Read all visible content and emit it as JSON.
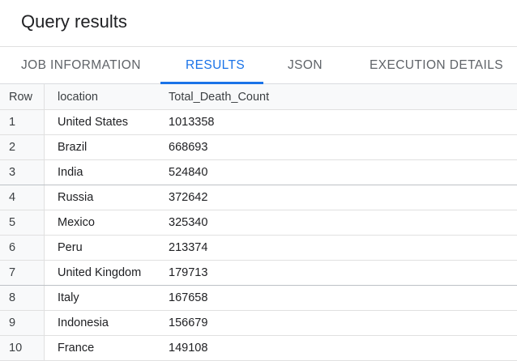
{
  "header": {
    "title": "Query results"
  },
  "tabs": [
    {
      "label": "JOB INFORMATION",
      "active": false
    },
    {
      "label": "RESULTS",
      "active": true
    },
    {
      "label": "JSON",
      "active": false
    },
    {
      "label": "EXECUTION DETAILS",
      "active": false
    }
  ],
  "colors": {
    "accent": "#1a73e8",
    "tab_inactive": "#5f6368",
    "row_gutter": "#f8f9fa"
  },
  "table": {
    "columns": [
      "Row",
      "location",
      "Total_Death_Count"
    ],
    "rows": [
      {
        "row": "1",
        "location": "United States",
        "total": "1013358"
      },
      {
        "row": "2",
        "location": "Brazil",
        "total": "668693"
      },
      {
        "row": "3",
        "location": "India",
        "total": "524840"
      },
      {
        "row": "4",
        "location": "Russia",
        "total": "372642"
      },
      {
        "row": "5",
        "location": "Mexico",
        "total": "325340"
      },
      {
        "row": "6",
        "location": "Peru",
        "total": "213374"
      },
      {
        "row": "7",
        "location": "United Kingdom",
        "total": "179713"
      },
      {
        "row": "8",
        "location": "Italy",
        "total": "167658"
      },
      {
        "row": "9",
        "location": "Indonesia",
        "total": "156679"
      },
      {
        "row": "10",
        "location": "France",
        "total": "149108"
      }
    ]
  }
}
